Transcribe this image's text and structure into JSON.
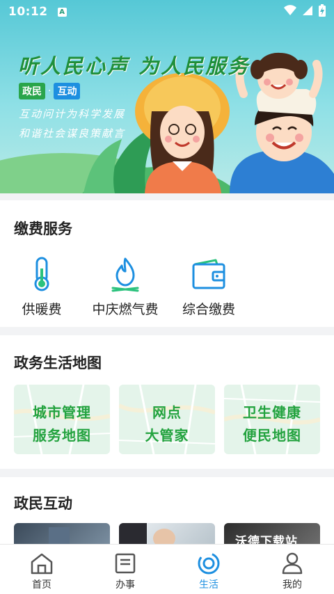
{
  "status_bar": {
    "time": "10:12",
    "notification_badge": "A"
  },
  "banner": {
    "slogan": "听人民心声 为人民服务",
    "tag_left": "政民",
    "tag_sep": "·",
    "tag_right": "互动",
    "line1": "互动问计为科学发展",
    "line2": "和谐社会谋良策献言"
  },
  "payment": {
    "title": "缴费服务",
    "items": [
      {
        "label": "供暖费",
        "icon": "thermometer-icon"
      },
      {
        "label": "中庆燃气费",
        "icon": "flame-icon"
      },
      {
        "label": "综合缴费",
        "icon": "wallet-icon"
      }
    ]
  },
  "life_map": {
    "title": "政务生活地图",
    "cards": [
      {
        "line1": "城市管理",
        "line2": "服务地图"
      },
      {
        "line1": "网点",
        "line2": "大管家"
      },
      {
        "line1": "卫生健康",
        "line2": "便民地图"
      }
    ]
  },
  "interaction": {
    "title": "政民互动",
    "watermark": "沃德下载站"
  },
  "tabbar": {
    "items": [
      {
        "label": "首页",
        "icon": "home-icon"
      },
      {
        "label": "办事",
        "icon": "document-icon"
      },
      {
        "label": "生活",
        "icon": "life-ring-icon"
      },
      {
        "label": "我的",
        "icon": "user-icon"
      }
    ]
  },
  "colors": {
    "accent": "#1d8fe0",
    "green": "#22a23e",
    "banner_bg": "#56c8d6"
  }
}
